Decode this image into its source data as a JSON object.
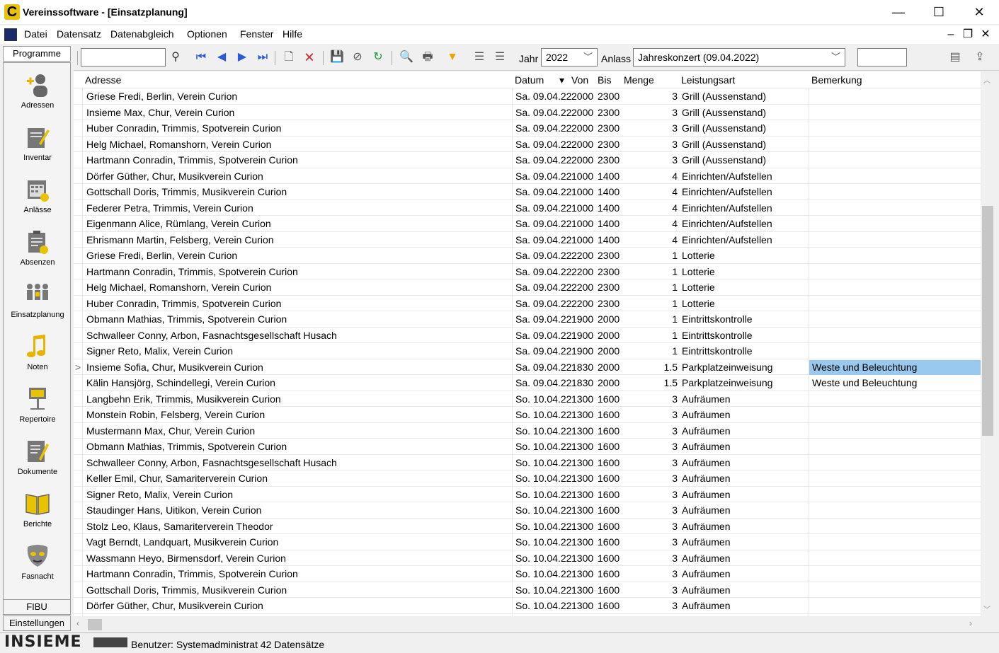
{
  "window": {
    "title": "Vereinssoftware - [Einsatzplanung]",
    "app_logo": "C",
    "minimize_symbol": "—",
    "maximize_symbol": "☐",
    "close_symbol": "✕"
  },
  "menu": {
    "items": [
      "Datei",
      "Datensatz",
      "Datenabgleich",
      "Optionen",
      "Fenster",
      "Hilfe"
    ],
    "mdi_minimize": "–",
    "mdi_restore": "❐",
    "mdi_close": "✕"
  },
  "sidebar": {
    "header": "Programme",
    "items": [
      {
        "label": "Adressen",
        "icon": "person-add-icon"
      },
      {
        "label": "Inventar",
        "icon": "notepad-icon"
      },
      {
        "label": "Anlässe",
        "icon": "calendar-icon"
      },
      {
        "label": "Absenzen",
        "icon": "clipboard-icon"
      },
      {
        "label": "Einsatzplanung",
        "icon": "team-icon"
      },
      {
        "label": "Noten",
        "icon": "music-note-icon"
      },
      {
        "label": "Repertoire",
        "icon": "music-stand-icon"
      },
      {
        "label": "Dokumente",
        "icon": "document-edit-icon"
      },
      {
        "label": "Berichte",
        "icon": "book-icon"
      },
      {
        "label": "Fasnacht",
        "icon": "mask-icon"
      }
    ],
    "bottom_buttons": [
      "FIBU",
      "Einstellungen"
    ]
  },
  "toolbar": {
    "search_value": "",
    "jahr_label": "Jahr",
    "jahr_value": "2022",
    "anlass_label": "Anlass",
    "anlass_value": "Jahreskonzert (09.04.2022)",
    "extra_value": ""
  },
  "grid": {
    "columns": [
      "Adresse",
      "Datum",
      "Von",
      "Bis",
      "Menge",
      "Leistungsart",
      "Bemerkung"
    ],
    "sort_indicator": "▾",
    "selected_row": 17,
    "selected_marker": ">",
    "rows": [
      [
        "Griese Fredi, Berlin, Verein Curion",
        "Sa. 09.04.22",
        "2000",
        "2300",
        "3",
        "Grill (Aussenstand)",
        ""
      ],
      [
        "Insieme Max, Chur, Verein Curion",
        "Sa. 09.04.22",
        "2000",
        "2300",
        "3",
        "Grill (Aussenstand)",
        ""
      ],
      [
        "Huber Conradin, Trimmis, Spotverein Curion",
        "Sa. 09.04.22",
        "2000",
        "2300",
        "3",
        "Grill (Aussenstand)",
        ""
      ],
      [
        "Helg Michael, Romanshorn, Verein Curion",
        "Sa. 09.04.22",
        "2000",
        "2300",
        "3",
        "Grill (Aussenstand)",
        ""
      ],
      [
        "Hartmann Conradin, Trimmis, Spotverein Curion",
        "Sa. 09.04.22",
        "2000",
        "2300",
        "3",
        "Grill (Aussenstand)",
        ""
      ],
      [
        "Dörfer Güther, Chur, Musikverein Curion",
        "Sa. 09.04.22",
        "1000",
        "1400",
        "4",
        "Einrichten/Aufstellen",
        ""
      ],
      [
        "Gottschall Doris, Trimmis, Musikverein Curion",
        "Sa. 09.04.22",
        "1000",
        "1400",
        "4",
        "Einrichten/Aufstellen",
        ""
      ],
      [
        "Federer Petra, Trimmis, Verein Curion",
        "Sa. 09.04.22",
        "1000",
        "1400",
        "4",
        "Einrichten/Aufstellen",
        ""
      ],
      [
        "Eigenmann Alice, Rümlang, Verein Curion",
        "Sa. 09.04.22",
        "1000",
        "1400",
        "4",
        "Einrichten/Aufstellen",
        ""
      ],
      [
        "Ehrismann Martin, Felsberg, Verein Curion",
        "Sa. 09.04.22",
        "1000",
        "1400",
        "4",
        "Einrichten/Aufstellen",
        ""
      ],
      [
        "Griese Fredi, Berlin, Verein Curion",
        "Sa. 09.04.22",
        "2200",
        "2300",
        "1",
        "Lotterie",
        ""
      ],
      [
        "Hartmann Conradin, Trimmis, Spotverein Curion",
        "Sa. 09.04.22",
        "2200",
        "2300",
        "1",
        "Lotterie",
        ""
      ],
      [
        "Helg Michael, Romanshorn, Verein Curion",
        "Sa. 09.04.22",
        "2200",
        "2300",
        "1",
        "Lotterie",
        ""
      ],
      [
        "Huber Conradin, Trimmis, Spotverein Curion",
        "Sa. 09.04.22",
        "2200",
        "2300",
        "1",
        "Lotterie",
        ""
      ],
      [
        "Obmann Mathias, Trimmis, Spotverein Curion",
        "Sa. 09.04.22",
        "1900",
        "2000",
        "1",
        "Eintrittskontrolle",
        ""
      ],
      [
        "Schwalleer Conny, Arbon, Fasnachtsgesellschaft Husach",
        "Sa. 09.04.22",
        "1900",
        "2000",
        "1",
        "Eintrittskontrolle",
        ""
      ],
      [
        "Signer Reto, Malix, Verein Curion",
        "Sa. 09.04.22",
        "1900",
        "2000",
        "1",
        "Eintrittskontrolle",
        ""
      ],
      [
        "Insieme Sofia, Chur, Musikverein Curion",
        "Sa. 09.04.22",
        "1830",
        "2000",
        "1.5",
        "Parkplatzeinweisung",
        "Weste und Beleuchtung"
      ],
      [
        "Kälin Hansjörg, Schindellegi, Verein Curion",
        "Sa. 09.04.22",
        "1830",
        "2000",
        "1.5",
        "Parkplatzeinweisung",
        "Weste und Beleuchtung"
      ],
      [
        "Langbehn Erik, Trimmis, Musikverein Curion",
        "So. 10.04.22",
        "1300",
        "1600",
        "3",
        "Aufräumen",
        ""
      ],
      [
        "Monstein Robin, Felsberg, Verein Curion",
        "So. 10.04.22",
        "1300",
        "1600",
        "3",
        "Aufräumen",
        ""
      ],
      [
        "Mustermann Max, Chur, Verein Curion",
        "So. 10.04.22",
        "1300",
        "1600",
        "3",
        "Aufräumen",
        ""
      ],
      [
        "Obmann Mathias, Trimmis, Spotverein Curion",
        "So. 10.04.22",
        "1300",
        "1600",
        "3",
        "Aufräumen",
        ""
      ],
      [
        "Schwalleer Conny, Arbon, Fasnachtsgesellschaft Husach",
        "So. 10.04.22",
        "1300",
        "1600",
        "3",
        "Aufräumen",
        ""
      ],
      [
        "Keller Emil, Chur, Samariterverein Curion",
        "So. 10.04.22",
        "1300",
        "1600",
        "3",
        "Aufräumen",
        ""
      ],
      [
        "Signer Reto, Malix, Verein Curion",
        "So. 10.04.22",
        "1300",
        "1600",
        "3",
        "Aufräumen",
        ""
      ],
      [
        "Staudinger Hans, Uitikon, Verein Curion",
        "So. 10.04.22",
        "1300",
        "1600",
        "3",
        "Aufräumen",
        ""
      ],
      [
        "Stolz Leo, Klaus, Samariterverein Theodor",
        "So. 10.04.22",
        "1300",
        "1600",
        "3",
        "Aufräumen",
        ""
      ],
      [
        "Vagt Berndt, Landquart, Musikverein Curion",
        "So. 10.04.22",
        "1300",
        "1600",
        "3",
        "Aufräumen",
        ""
      ],
      [
        "Wassmann Heyo, Birmensdorf, Verein Curion",
        "So. 10.04.22",
        "1300",
        "1600",
        "3",
        "Aufräumen",
        ""
      ],
      [
        "Hartmann Conradin, Trimmis, Spotverein Curion",
        "So. 10.04.22",
        "1300",
        "1600",
        "3",
        "Aufräumen",
        ""
      ],
      [
        "Gottschall Doris, Trimmis, Musikverein Curion",
        "So. 10.04.22",
        "1300",
        "1600",
        "3",
        "Aufräumen",
        ""
      ],
      [
        "Dörfer Güther, Chur, Musikverein Curion",
        "So. 10.04.22",
        "1300",
        "1600",
        "3",
        "Aufräumen",
        ""
      ]
    ]
  },
  "status": {
    "brand": "INSIEME",
    "user_text": "Benutzer: Systemadministrat 42 Datensätze"
  },
  "colors": {
    "selected_cell": "#99c9ef",
    "accent_icon": "#2a5bd7"
  }
}
